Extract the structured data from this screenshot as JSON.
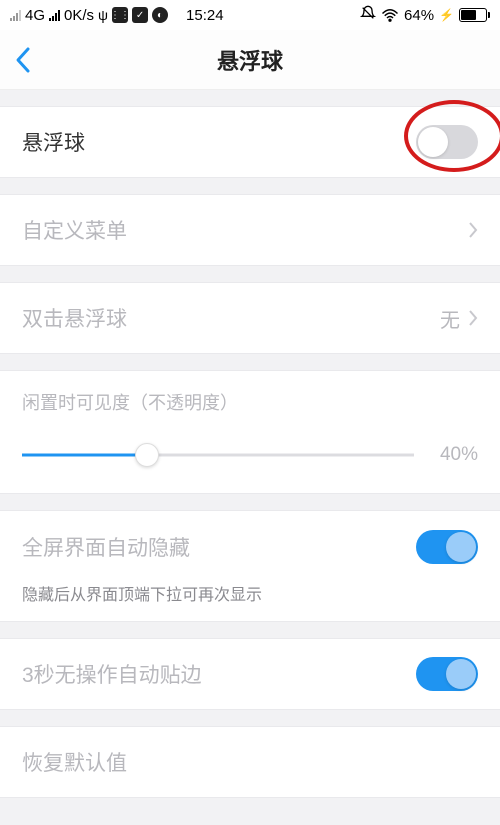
{
  "status_bar": {
    "network_type": "4G",
    "data_rate": "0K/s",
    "time": "15:24",
    "battery_percent": "64%",
    "battery_fill_pct": 64
  },
  "header": {
    "title": "悬浮球"
  },
  "rows": {
    "floatball": {
      "label": "悬浮球",
      "toggle_on": false
    },
    "custom_menu": {
      "label": "自定义菜单"
    },
    "double_tap": {
      "label": "双击悬浮球",
      "value": "无"
    },
    "opacity": {
      "caption": "闲置时可见度（不透明度）",
      "percent": 40,
      "display": "40%"
    },
    "auto_hide": {
      "label": "全屏界面自动隐藏",
      "subtext": "隐藏后从界面顶端下拉可再次显示",
      "toggle_on": true
    },
    "auto_edge": {
      "label": "3秒无操作自动贴边",
      "toggle_on": true
    },
    "reset": {
      "label": "恢复默认值"
    }
  }
}
